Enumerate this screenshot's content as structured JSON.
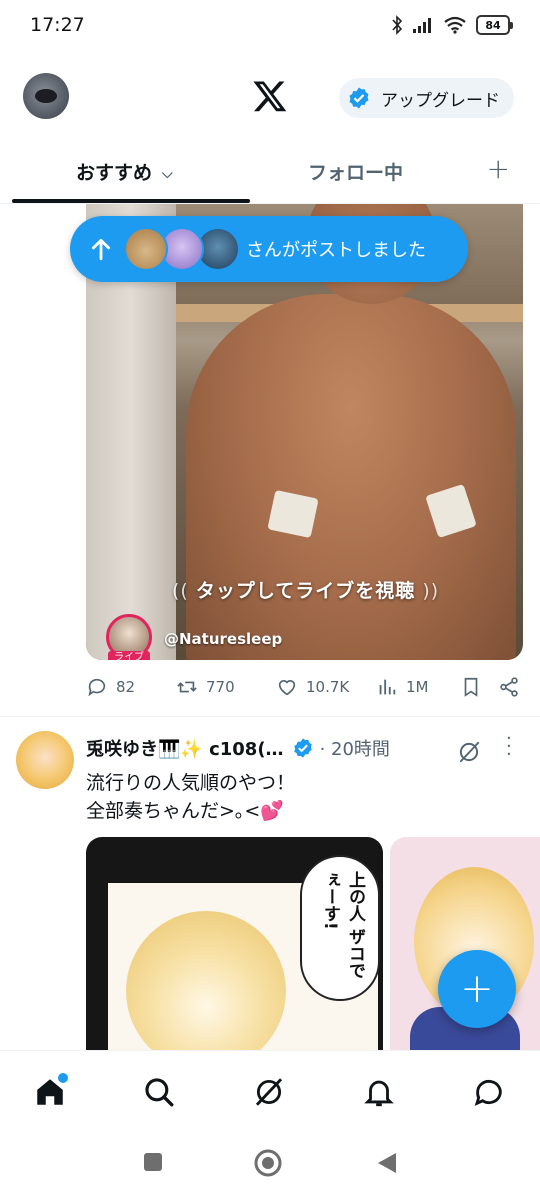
{
  "status_bar": {
    "time": "17:27",
    "battery": "84"
  },
  "top_bar": {
    "upgrade_label": "アップグレード"
  },
  "tabs": {
    "recommend": "おすすめ",
    "following": "フォロー中",
    "add": "+"
  },
  "posted_pill": {
    "text": "さんがポストしました"
  },
  "live_post": {
    "caption": "タップしてライブを視聴",
    "live_badge": "ライブ",
    "handle": "@Naturesleep",
    "replies": "82",
    "reposts": "770",
    "likes": "10.7K",
    "views": "1M"
  },
  "post2": {
    "name": "兎咲ゆき🎹✨ c108(…",
    "time": "· 20時間",
    "line1": "流行りの人気順のやつ！",
    "line2": "全部奏ちゃんだ>｡<💕",
    "bubble": "上の人 ザコでぇーす!"
  },
  "fab": {
    "label": "+"
  },
  "colors": {
    "accent": "#1d9bf0",
    "text": "#0f1419",
    "muted": "#536471"
  }
}
